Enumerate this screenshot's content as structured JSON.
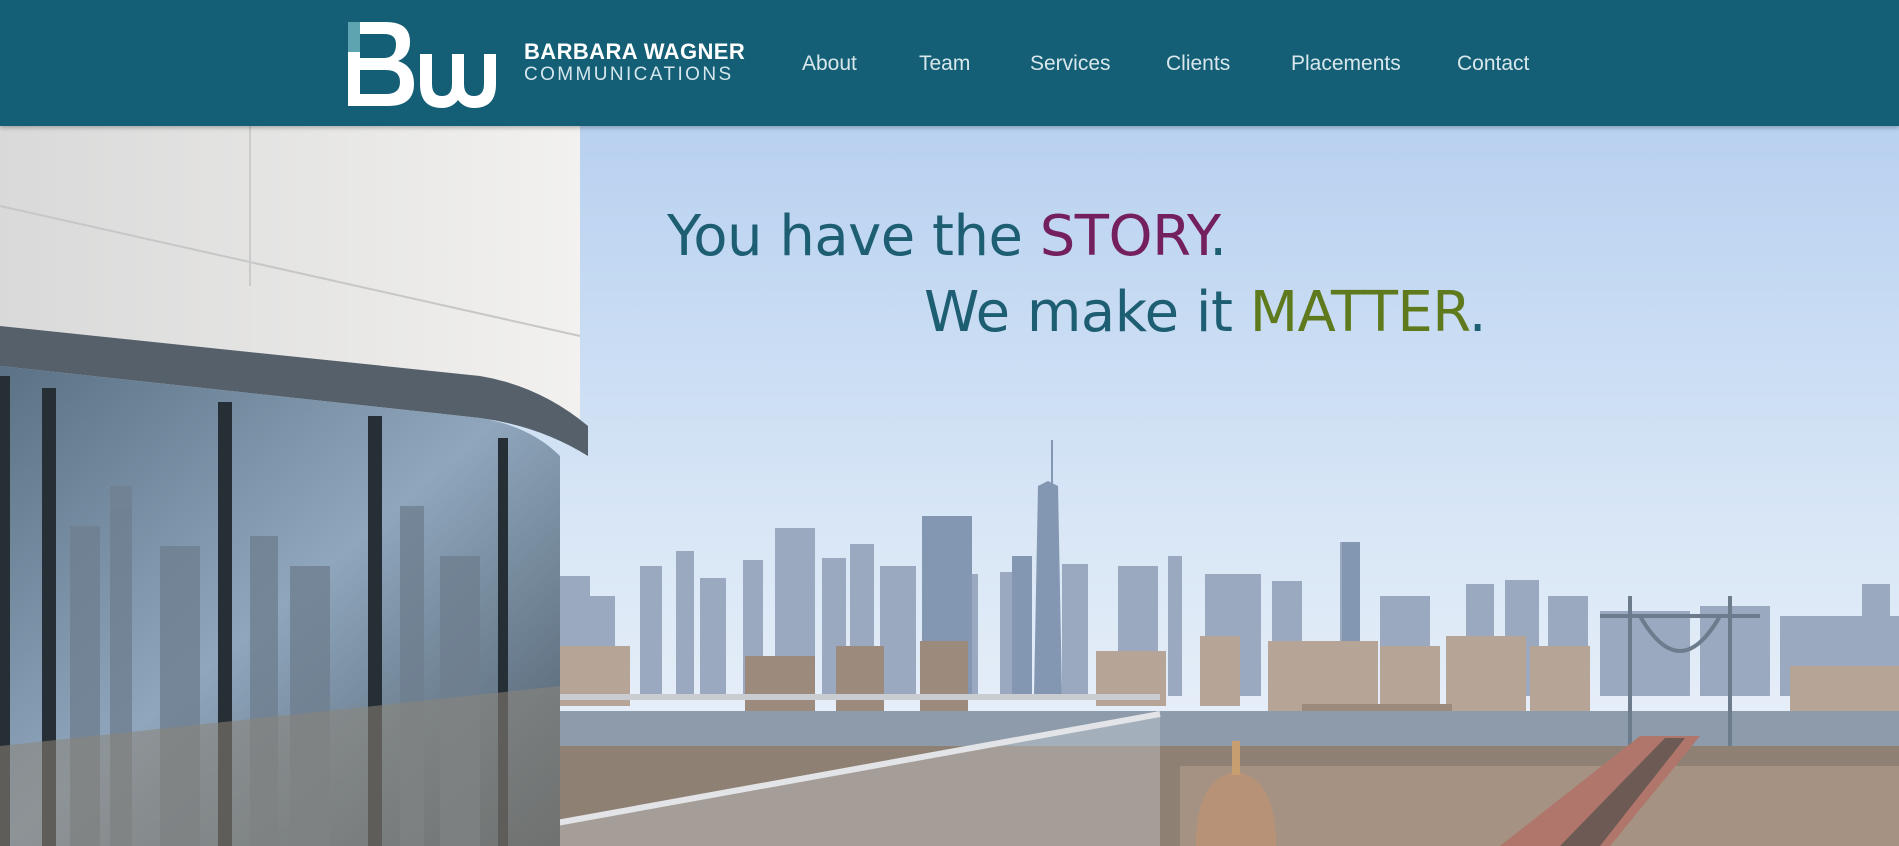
{
  "brand": {
    "logo_text": "Bw",
    "name": "BARBARA WAGNER",
    "subtitle": "COMMUNICATIONS"
  },
  "nav": {
    "items": [
      {
        "label": "About"
      },
      {
        "label": "Team"
      },
      {
        "label": "Services"
      },
      {
        "label": "Clients"
      },
      {
        "label": "Placements"
      },
      {
        "label": "Contact"
      }
    ]
  },
  "hero": {
    "line1": {
      "prefix": "You have the ",
      "keyword": "STORY",
      "suffix": "."
    },
    "line2": {
      "prefix": "We make it ",
      "keyword": "MATTER",
      "suffix": "."
    },
    "image_description_icon": "city-skyline-photo"
  },
  "colors": {
    "header_bg": "#145f75",
    "headline_text": "#1d5e73",
    "story_accent": "#74205f",
    "matter_accent": "#5e7a1c"
  }
}
